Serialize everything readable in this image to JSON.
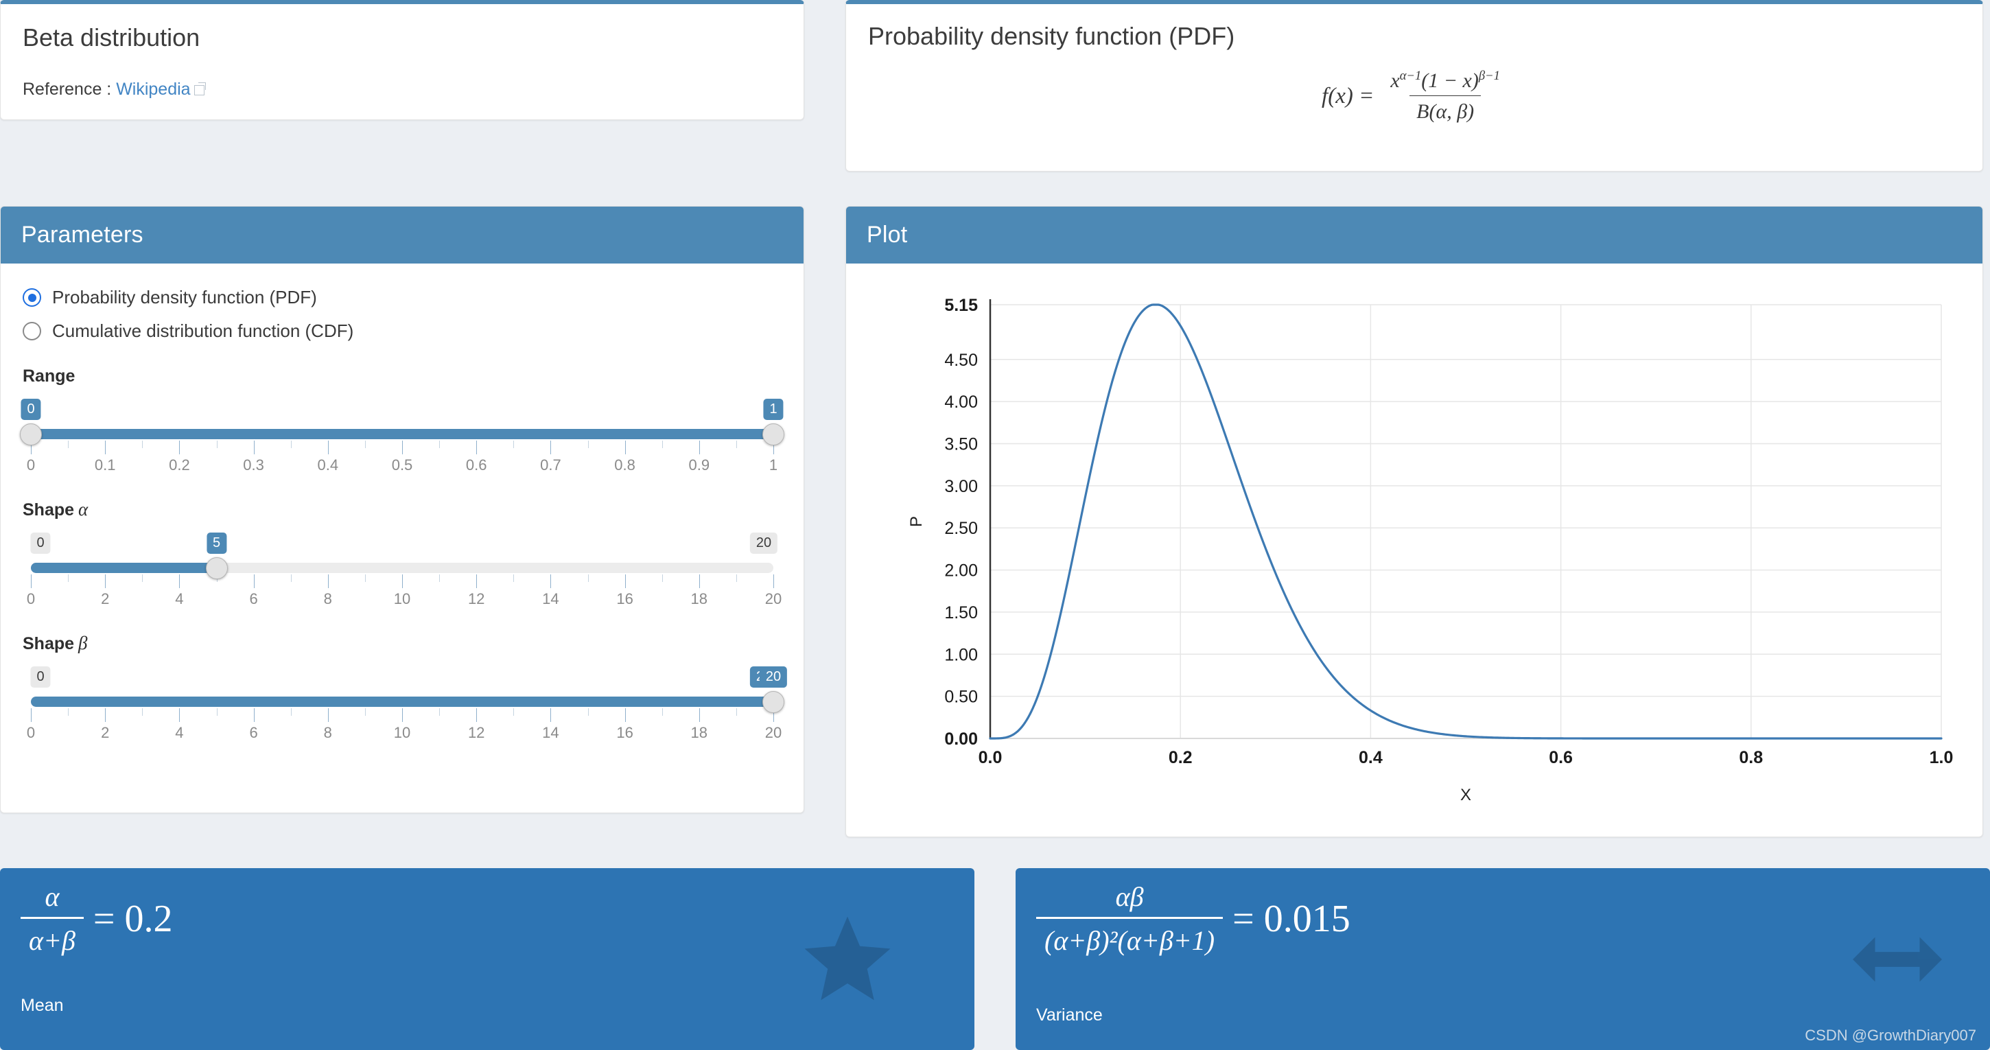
{
  "app": {
    "title": "Beta distribution",
    "reference_label": "Reference :",
    "reference_link_text": "Wikipedia",
    "external_link_icon": "external-link-icon",
    "accent_color": "#4d89b5",
    "stat_card_color": "#2d74b3",
    "page_background": "#eceff3"
  },
  "pdf_panel": {
    "title": "Probability density function (PDF)",
    "formula_lhs": "f(x) =",
    "formula_numerator": "xα−1(1 − x)β−1",
    "formula_denominator": "B(α, β)",
    "numerator_base_x": "x",
    "numerator_exp1": "α−1",
    "numerator_mid": "(1 − x)",
    "numerator_exp2": "β−1",
    "denominator_text": "B(α, β)"
  },
  "parameters_panel": {
    "header": "Parameters",
    "function_options": [
      {
        "label": "Probability density function (PDF)",
        "selected": true
      },
      {
        "label": "Cumulative distribution function (CDF)",
        "selected": false
      }
    ],
    "sliders": [
      {
        "name": "range",
        "label": "Range",
        "greek": "",
        "min": 0,
        "max": 1,
        "low_value": "0",
        "high_value": "1",
        "low_num": 0,
        "high_num": 1,
        "dual": true,
        "low_badge_state": "active",
        "high_badge_state": "active",
        "tick_labels": [
          "0",
          "0.1",
          "0.2",
          "0.3",
          "0.4",
          "0.5",
          "0.6",
          "0.7",
          "0.8",
          "0.9",
          "1"
        ],
        "minor_per_major": 2
      },
      {
        "name": "shape-alpha",
        "label": "Shape",
        "greek": "α",
        "min": 0,
        "max": 20,
        "low_value": "0",
        "high_value": "20",
        "value": "5",
        "value_num": 5,
        "dual": false,
        "low_badge_state": "inactive",
        "high_badge_state": "inactive",
        "tick_labels": [
          "0",
          "2",
          "4",
          "6",
          "8",
          "10",
          "12",
          "14",
          "16",
          "18",
          "20"
        ],
        "minor_per_major": 2
      },
      {
        "name": "shape-beta",
        "label": "Shape",
        "greek": "β",
        "min": 0,
        "max": 20,
        "low_value": "0",
        "high_value": "20",
        "value": "20",
        "value_num": 20,
        "dual": false,
        "low_badge_state": "inactive",
        "high_badge_state": "active",
        "tick_labels": [
          "0",
          "2",
          "4",
          "6",
          "8",
          "10",
          "12",
          "14",
          "16",
          "18",
          "20"
        ],
        "minor_per_major": 2
      }
    ]
  },
  "plot_panel": {
    "header": "Plot"
  },
  "chart_data": {
    "type": "line",
    "title": "",
    "xlabel": "X",
    "ylabel": "P",
    "xlim": [
      0,
      1
    ],
    "ylim": [
      0,
      5.15
    ],
    "grid": true,
    "legend": "none",
    "line_color": "#3d7ab3",
    "x_ticks": [
      "0.0",
      "0.2",
      "0.4",
      "0.6",
      "0.8",
      "1.0"
    ],
    "x_tick_values": [
      0.0,
      0.2,
      0.4,
      0.6,
      0.8,
      1.0
    ],
    "y_ticks": [
      "0.00",
      "0.50",
      "1.00",
      "1.50",
      "2.00",
      "2.50",
      "3.00",
      "3.50",
      "4.00",
      "4.50",
      "5.15"
    ],
    "y_tick_values": [
      0.0,
      0.5,
      1.0,
      1.5,
      2.0,
      2.5,
      3.0,
      3.5,
      4.0,
      4.5,
      5.15
    ],
    "bold_y_ticks": [
      "0.00",
      "5.15"
    ],
    "distribution": "Beta",
    "alpha": 5,
    "beta": 20,
    "peak_x": 0.174,
    "peak_y": 5.15,
    "series": [
      {
        "name": "Beta PDF (alpha=5, beta=20)",
        "x": [
          0.0,
          0.02,
          0.04,
          0.06,
          0.08,
          0.1,
          0.12,
          0.14,
          0.16,
          0.174,
          0.18,
          0.2,
          0.22,
          0.24,
          0.26,
          0.28,
          0.3,
          0.32,
          0.34,
          0.36,
          0.38,
          0.4,
          0.42,
          0.44,
          0.46,
          0.48,
          0.5,
          0.55,
          0.6,
          0.7,
          0.8,
          0.9,
          1.0
        ],
        "y": [
          0.0,
          0.18,
          1.05,
          2.2,
          3.32,
          4.2,
          4.78,
          5.07,
          5.14,
          5.15,
          5.13,
          4.92,
          4.56,
          4.1,
          3.58,
          3.04,
          2.52,
          2.03,
          1.6,
          1.23,
          0.92,
          0.67,
          0.47,
          0.32,
          0.21,
          0.14,
          0.08,
          0.02,
          0.0,
          0.0,
          0.0,
          0.0,
          0.0
        ]
      }
    ]
  },
  "stats": [
    {
      "name": "mean",
      "numerator": "α",
      "denominator": "α+β",
      "equals": "=",
      "value": "0.2",
      "label": "Mean",
      "icon": "star-icon"
    },
    {
      "name": "variance",
      "numerator": "αβ",
      "denominator": "(α+β)²(α+β+1)",
      "equals": "=",
      "value": "0.015",
      "label": "Variance",
      "icon": "left-right-arrow-icon"
    }
  ],
  "watermark": "CSDN @GrowthDiary007"
}
